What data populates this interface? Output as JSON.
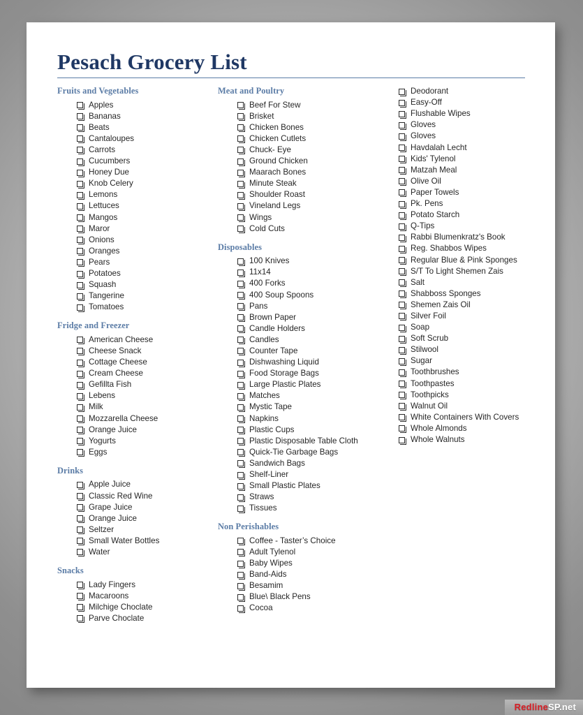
{
  "document": {
    "title": "Pesach Grocery List"
  },
  "watermark": {
    "brand": "Redline",
    "suffix": "SP.net"
  },
  "columns": [
    {
      "sections": [
        {
          "title": "Fruits and Vegetables",
          "items": [
            "Apples",
            "Bananas",
            "Beats",
            "Cantaloupes",
            "Carrots",
            "Cucumbers",
            "Honey Due",
            "Knob Celery",
            "Lemons",
            "Lettuces",
            "Mangos",
            "Maror",
            "Onions",
            "Oranges",
            "Pears",
            "Potatoes",
            "Squash",
            "Tangerine",
            "Tomatoes"
          ]
        },
        {
          "title": "Fridge and Freezer",
          "items": [
            "American Cheese",
            "Cheese Snack",
            "Cottage Cheese",
            "Cream Cheese",
            "Gefillta Fish",
            "Lebens",
            "Milk",
            "Mozzarella Cheese",
            "Orange Juice",
            "Yogurts",
            "Eggs"
          ]
        },
        {
          "title": "Drinks",
          "items": [
            "Apple Juice",
            "Classic Red Wine",
            "Grape Juice",
            "Orange Juice",
            "Seltzer",
            "Small Water Bottles",
            "Water"
          ]
        },
        {
          "title": "Snacks",
          "items": [
            "Lady Fingers",
            "Macaroons",
            "Milchige Choclate",
            "Parve Choclate"
          ]
        }
      ]
    },
    {
      "sections": [
        {
          "title": "Meat and Poultry",
          "items": [
            "Beef For Stew",
            "Brisket",
            "Chicken Bones",
            "Chicken Cutlets",
            "Chuck- Eye",
            "Ground Chicken",
            "Maarach Bones",
            "Minute Steak",
            "Shoulder Roast",
            "Vineland Legs",
            "Wings",
            "Cold Cuts"
          ]
        },
        {
          "title": "Disposables",
          "items": [
            "100 Knives",
            "11x14",
            "400 Forks",
            "400 Soup Spoons",
            "Pans",
            "Brown Paper",
            "Candle Holders",
            "Candles",
            "Counter Tape",
            "Dishwashing Liquid",
            "Food Storage Bags",
            "Large Plastic Plates",
            "Matches",
            "Mystic Tape",
            "Napkins",
            "Plastic Cups",
            "Plastic Disposable Table Cloth",
            "Quick-Tie Garbage Bags",
            "Sandwich Bags",
            "Shelf-Liner",
            "Small Plastic Plates",
            "Straws",
            "Tissues"
          ]
        },
        {
          "title": "Non Perishables",
          "items": [
            "Coffee - Taster’s Choice",
            "Adult Tylenol",
            "Baby Wipes",
            "Band-Aids",
            "Besamim",
            "Blue\\ Black Pens",
            "Cocoa"
          ]
        }
      ]
    },
    {
      "sections": [
        {
          "title": "Non Perishables (continued)",
          "title_hidden": true,
          "items": [
            "Deodorant",
            "Easy-Off",
            "Flushable Wipes",
            "Gloves",
            "Gloves",
            "Havdalah Lecht",
            "Kids' Tylenol",
            "Matzah Meal",
            "Olive Oil",
            "Paper Towels",
            "Pk. Pens",
            "Potato Starch",
            "Q-Tips",
            "Rabbi Blumenkratz's Book",
            "Reg. Shabbos Wipes",
            "Regular Blue & Pink Sponges",
            "S/T To Light Shemen Zais",
            "Salt",
            "Shabboss Sponges",
            "Shemen Zais Oil",
            "Silver Foil",
            "Soap",
            "Soft Scrub",
            "Stilwool",
            "Sugar",
            "Toothbrushes",
            "Toothpastes",
            "Toothpicks",
            "Walnut Oil",
            "White Containers With Covers",
            "Whole Almonds",
            "Whole Walnuts"
          ]
        }
      ]
    }
  ]
}
